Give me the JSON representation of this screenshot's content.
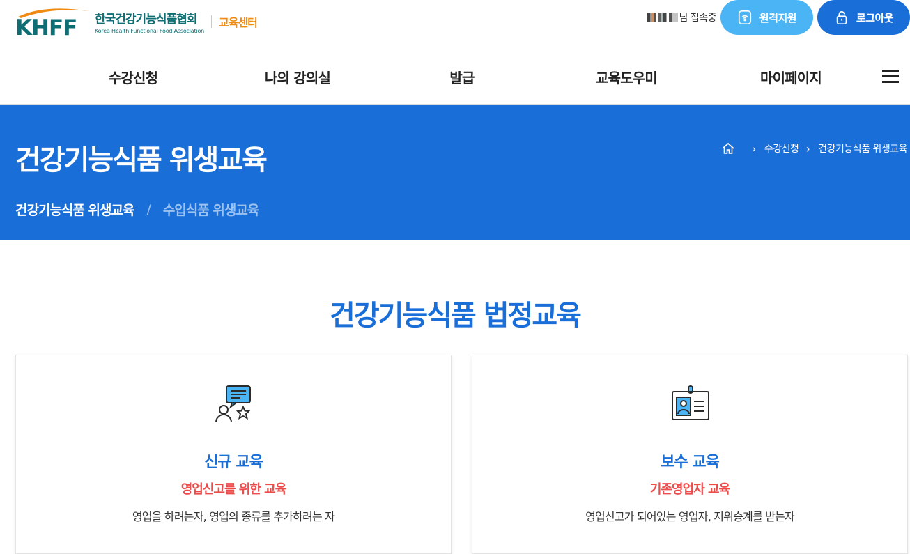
{
  "header": {
    "logo": {
      "letters": "KHFF",
      "name_kr": "한국건강기능식품협회",
      "name_en": "Korea Health Functional Food Association",
      "center_label": "교육센터"
    },
    "user": {
      "status_text": "님 접속중"
    },
    "remote_support_label": "원격지원",
    "logout_label": "로그아웃"
  },
  "nav": {
    "items": [
      {
        "label": "수강신청"
      },
      {
        "label": "나의 강의실"
      },
      {
        "label": "발급"
      },
      {
        "label": "교육도우미"
      },
      {
        "label": "마이페이지"
      }
    ]
  },
  "banner": {
    "title": "건강기능식품 위생교육",
    "breadcrumb": [
      "수강신청",
      "건강기능식품 위생교육"
    ],
    "tabs": [
      {
        "label": "건강기능식품 위생교육"
      },
      {
        "label": "수입식품 위생교육"
      }
    ],
    "tab_separator": "/"
  },
  "content": {
    "section_title": "건강기능식품 법정교육",
    "cards": [
      {
        "icon": "speech-bubble-user-star-icon",
        "title": "신규 교육",
        "subtitle": "영업신고를 위한 교육",
        "description": "영업을 하려는자, 영업의 종류를 추가하려는 자"
      },
      {
        "icon": "id-badge-icon",
        "title": "보수 교육",
        "subtitle": "기존영업자 교육",
        "description": "영업신고가 되어있는 영업자, 지위승계를 받는자"
      }
    ]
  },
  "colors": {
    "primary": "#1a6ed8",
    "remote_button": "#4bb4f5",
    "logo_teal": "#0e6e73",
    "logo_orange": "#f08a12",
    "accent_red": "#ee4b4b",
    "inactive_tab": "#9cc2f0"
  }
}
